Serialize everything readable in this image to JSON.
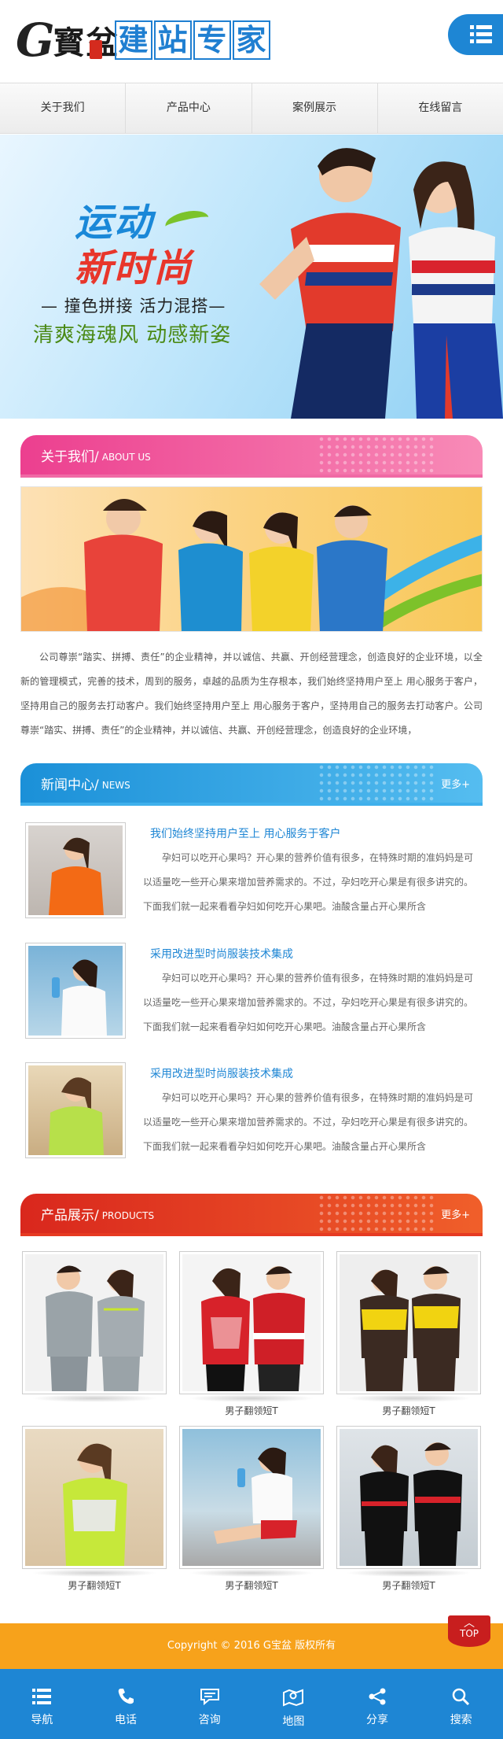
{
  "header": {
    "logo_g": "G",
    "logo_bao": "寳盆",
    "logo_title": [
      "建",
      "站",
      "专",
      "家"
    ]
  },
  "nav": {
    "items": [
      "关于我们",
      "产品中心",
      "案例展示",
      "在线留言"
    ]
  },
  "banner": {
    "title_line1": "运动",
    "title_line2": "新时尚",
    "tagline": "— 撞色拼接 活力混搭—",
    "subtitle": "清爽海魂风 动感新姿"
  },
  "about": {
    "title": "关于我们/",
    "title_en": "ABOUT US",
    "text": "公司尊崇“踏实、拼搏、责任”的企业精神，并以诚信、共赢、开创经营理念，创造良好的企业环境，以全新的管理模式，完善的技术，周到的服务，卓越的品质为生存根本，我们始终坚持用户至上 用心服务于客户，坚持用自己的服务去打动客户。我们始终坚持用户至上 用心服务于客户，坚持用自己的服务去打动客户。公司尊崇“踏实、拼搏、责任”的企业精神，并以诚信、共赢、开创经营理念，创造良好的企业环境，"
  },
  "news": {
    "title": "新闻中心/",
    "title_en": "NEWS",
    "more": "更多+",
    "items": [
      {
        "title": "我们始终坚持用户至上 用心服务于客户",
        "desc": "孕妇可以吃开心果吗？开心果的营养价值有很多，在特殊时期的准妈妈是可以适量吃一些开心果来增加营养需求的。不过，孕妇吃开心果是有很多讲究的。下面我们就一起来看看孕妇如何吃开心果吧。油酸含量占开心果所含"
      },
      {
        "title": "采用改进型时尚服装技术集成",
        "desc": "孕妇可以吃开心果吗？开心果的营养价值有很多，在特殊时期的准妈妈是可以适量吃一些开心果来增加营养需求的。不过，孕妇吃开心果是有很多讲究的。下面我们就一起来看看孕妇如何吃开心果吧。油酸含量占开心果所含"
      },
      {
        "title": "采用改进型时尚服装技术集成",
        "desc": "孕妇可以吃开心果吗？开心果的营养价值有很多，在特殊时期的准妈妈是可以适量吃一些开心果来增加营养需求的。不过，孕妇吃开心果是有很多讲究的。下面我们就一起来看看孕妇如何吃开心果吧。油酸含量占开心果所含"
      }
    ]
  },
  "products": {
    "title": "产品展示/",
    "title_en": "PRODUCTS",
    "more": "更多+",
    "items": [
      {
        "name": ""
      },
      {
        "name": "男子翻领短T"
      },
      {
        "name": "男子翻领短T"
      },
      {
        "name": "男子翻领短T"
      },
      {
        "name": "男子翻领短T"
      },
      {
        "name": "男子翻领短T"
      }
    ]
  },
  "footer": {
    "copyright": "Copyright © 2016 G宝盆 版权所有",
    "top": "TOP"
  },
  "tabbar": {
    "items": [
      {
        "label": "导航",
        "icon": "list-icon"
      },
      {
        "label": "电话",
        "icon": "phone-icon"
      },
      {
        "label": "咨询",
        "icon": "chat-icon"
      },
      {
        "label": "地图",
        "icon": "map-icon"
      },
      {
        "label": "分享",
        "icon": "share-icon"
      },
      {
        "label": "搜索",
        "icon": "search-icon"
      }
    ]
  },
  "colors": {
    "primary_blue": "#1e86d4",
    "about_pink": "#ec3f8f",
    "news_blue": "#1b90d8",
    "product_red": "#d9271d",
    "footer_orange": "#f7a21b"
  }
}
